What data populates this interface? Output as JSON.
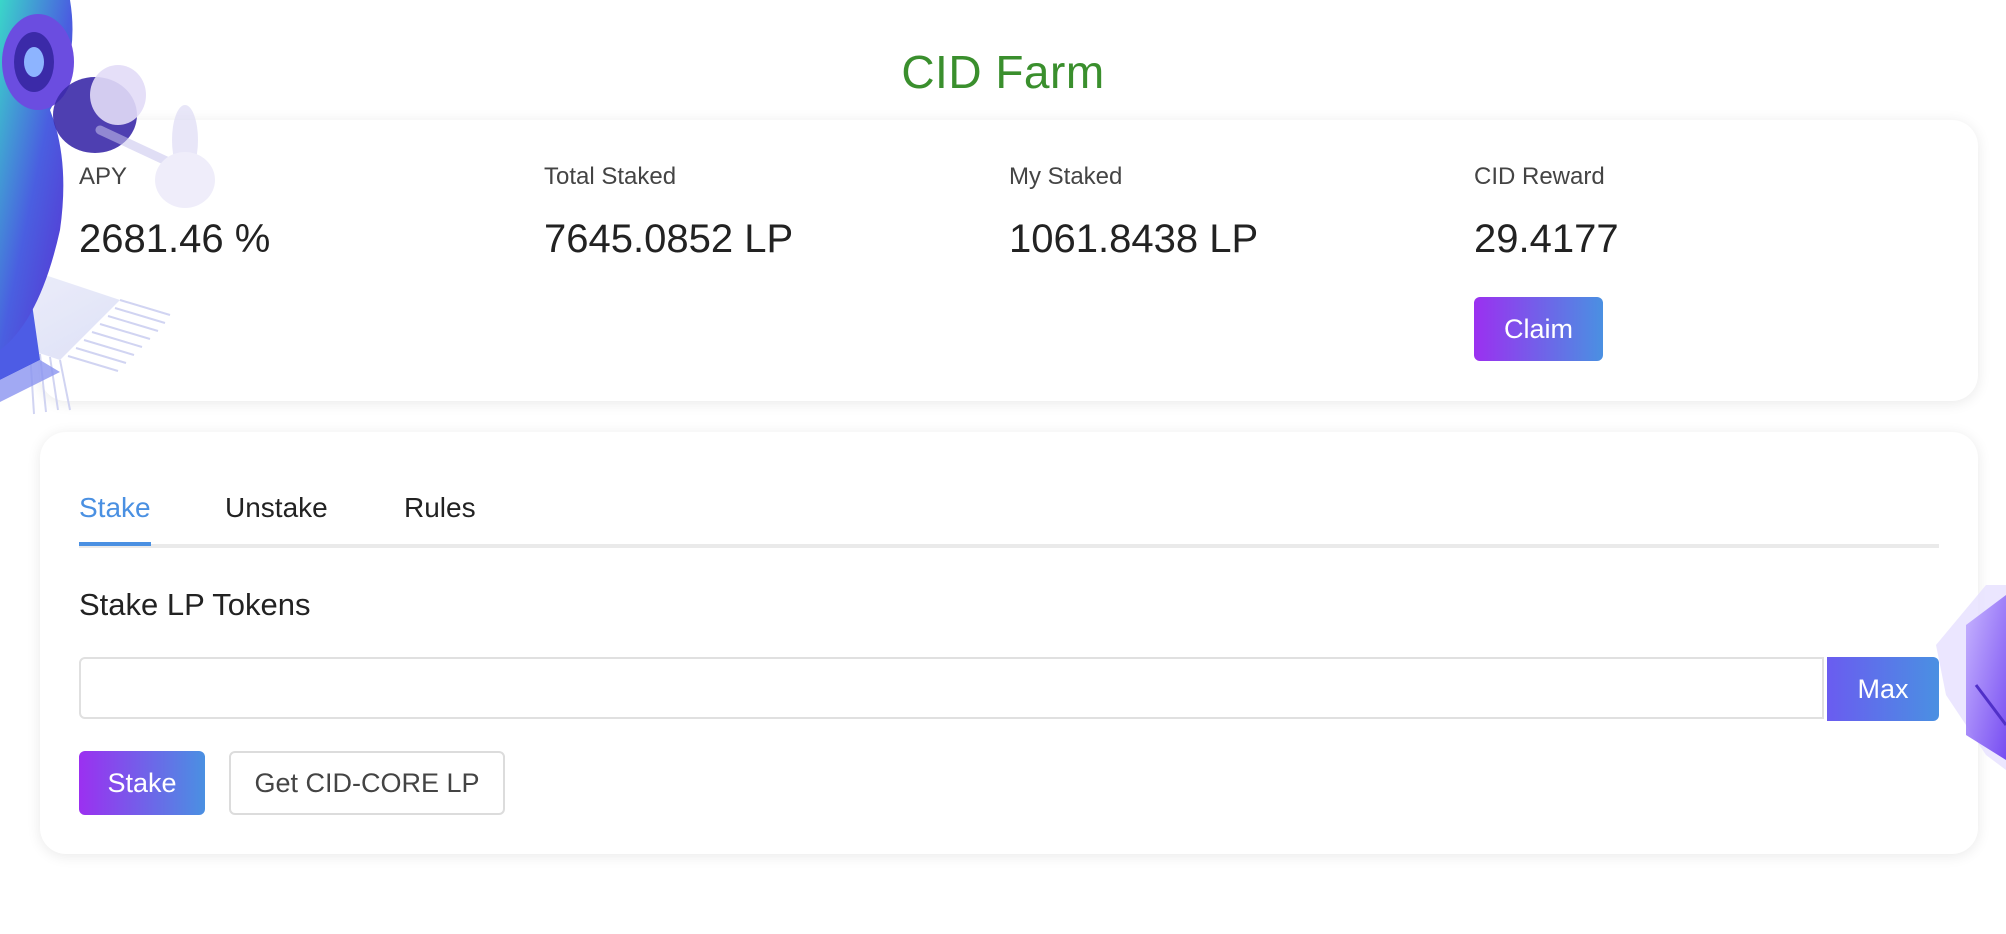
{
  "page": {
    "title": "CID Farm"
  },
  "stats": {
    "apy": {
      "label": "APY",
      "value": "2681.46 %"
    },
    "total_staked": {
      "label": "Total Staked",
      "value": "7645.0852 LP"
    },
    "my_staked": {
      "label": "My Staked",
      "value": "1061.8438 LP"
    },
    "cid_reward": {
      "label": "CID Reward",
      "value": "29.4177"
    },
    "claim_label": "Claim"
  },
  "tabs": [
    {
      "label": "Stake",
      "active": true
    },
    {
      "label": "Unstake",
      "active": false
    },
    {
      "label": "Rules",
      "active": false
    }
  ],
  "stake_panel": {
    "heading": "Stake LP Tokens",
    "input_value": "",
    "input_placeholder": "",
    "max_label": "Max",
    "stake_label": "Stake",
    "get_lp_label": "Get CID-CORE LP"
  },
  "colors": {
    "title_green": "#3a8f2d",
    "gradient_start": "#9b30f0",
    "gradient_end": "#4a90e2",
    "active_tab": "#4a90e2"
  },
  "icons": {
    "left_decoration": "robot-chip-illustration",
    "right_decoration": "purple-cube-illustration"
  }
}
